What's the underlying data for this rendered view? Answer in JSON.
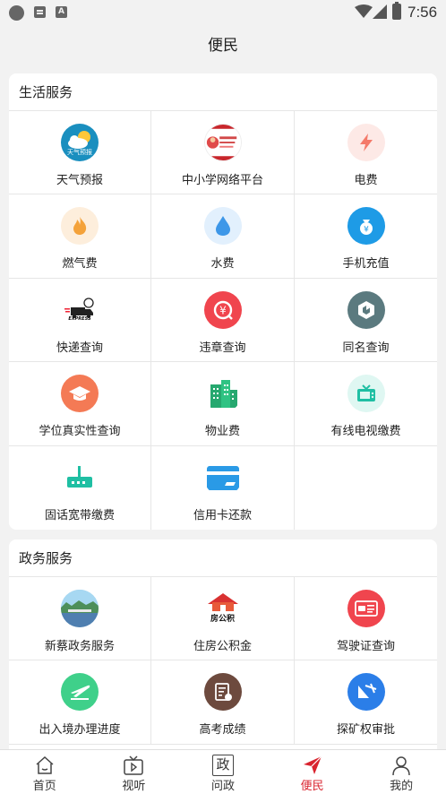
{
  "status_bar": {
    "time": "7:56",
    "a_icon": "A"
  },
  "header": {
    "title": "便民"
  },
  "life_section": {
    "title": "生活服务",
    "items": [
      {
        "label": "天气预报",
        "icon": "weather-icon",
        "badge": "天气预报"
      },
      {
        "label": "中小学网络平台",
        "icon": "school-platform-icon"
      },
      {
        "label": "电费",
        "icon": "electricity-icon"
      },
      {
        "label": "燃气费",
        "icon": "gas-icon"
      },
      {
        "label": "水费",
        "icon": "water-icon"
      },
      {
        "label": "手机充值",
        "icon": "phone-recharge-icon"
      },
      {
        "label": "快递查询",
        "icon": "express-icon",
        "badge": "EXPRESS"
      },
      {
        "label": "违章查询",
        "icon": "traffic-violation-icon"
      },
      {
        "label": "同名查询",
        "icon": "same-name-icon"
      },
      {
        "label": "学位真实性查询",
        "icon": "degree-icon"
      },
      {
        "label": "物业费",
        "icon": "property-icon"
      },
      {
        "label": "有线电视缴费",
        "icon": "cable-tv-icon"
      },
      {
        "label": "固话宽带缴费",
        "icon": "broadband-icon"
      },
      {
        "label": "信用卡还款",
        "icon": "credit-card-icon"
      }
    ]
  },
  "gov_section": {
    "title": "政务服务",
    "items": [
      {
        "label": "新蔡政务服务",
        "icon": "gov-service-icon"
      },
      {
        "label": "住房公积金",
        "icon": "housing-fund-icon",
        "badge": "房公积"
      },
      {
        "label": "驾驶证查询",
        "icon": "driver-license-icon"
      },
      {
        "label": "出入境办理进度",
        "icon": "immigration-icon"
      },
      {
        "label": "高考成绩",
        "icon": "exam-score-icon"
      },
      {
        "label": "探矿权审批",
        "icon": "mining-icon"
      }
    ]
  },
  "tabbar": {
    "items": [
      {
        "label": "首页",
        "icon": "home-icon"
      },
      {
        "label": "视听",
        "icon": "tv-icon"
      },
      {
        "label": "问政",
        "icon": "gov-question-icon",
        "glyph": "政"
      },
      {
        "label": "便民",
        "icon": "send-icon",
        "active": true
      },
      {
        "label": "我的",
        "icon": "user-icon"
      }
    ]
  },
  "colors": {
    "accent": "#d9232e"
  }
}
